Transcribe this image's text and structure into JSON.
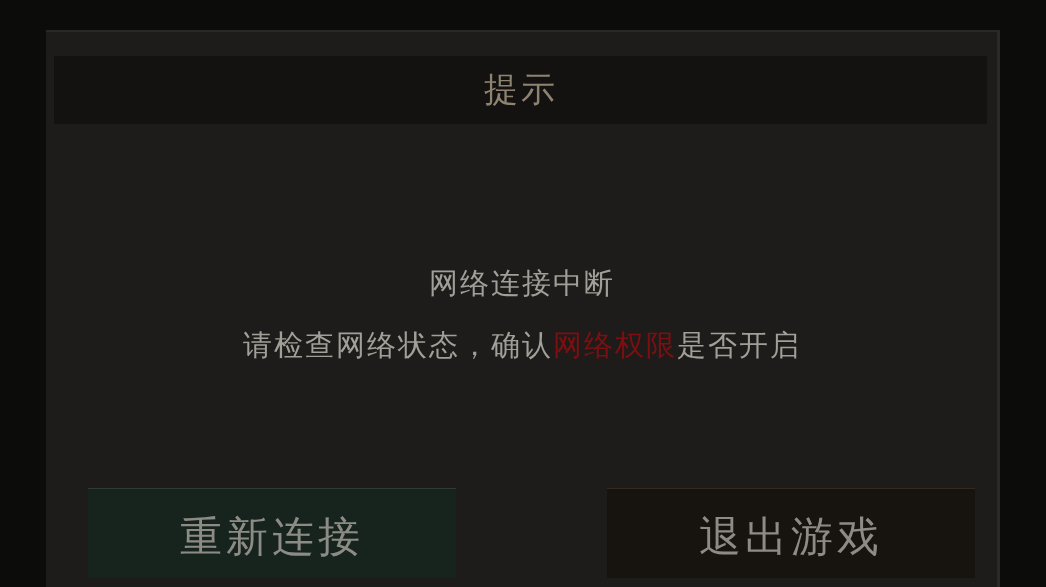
{
  "dialog": {
    "title": "提示",
    "message": [
      {
        "parts": [
          {
            "text": "网络连接中断",
            "highlight": false
          }
        ]
      },
      {
        "parts": [
          {
            "text": "请检查网络状态，确认",
            "highlight": false
          },
          {
            "text": "网络权限",
            "highlight": true
          },
          {
            "text": "是否开启",
            "highlight": false
          }
        ]
      }
    ],
    "buttons": [
      {
        "label": "重新连接",
        "kind": "confirm"
      },
      {
        "label": "退出游戏",
        "kind": "cancel"
      }
    ]
  }
}
